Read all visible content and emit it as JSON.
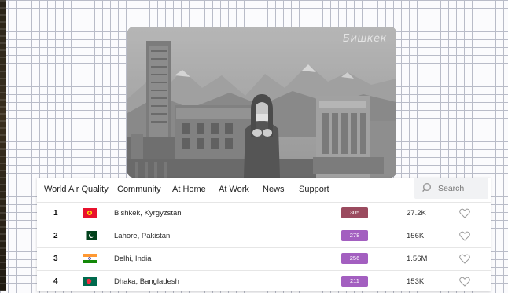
{
  "hero": {
    "city_caption": "Бишкек"
  },
  "nav": {
    "brand": "World Air Quality",
    "items": [
      "Community",
      "At Home",
      "At Work",
      "News",
      "Support"
    ]
  },
  "search": {
    "label": "Search",
    "icon": "search-icon"
  },
  "rows": [
    {
      "rank": "1",
      "city": "Bishkek, Kyrgyzstan",
      "aqi": "305",
      "aqi_color": "#9a4a5e",
      "count": "27.2K",
      "flag": "kyrgyzstan-flag"
    },
    {
      "rank": "2",
      "city": "Lahore, Pakistan",
      "aqi": "278",
      "aqi_color": "#a35fc0",
      "count": "156K",
      "flag": "pakistan-flag"
    },
    {
      "rank": "3",
      "city": "Delhi, India",
      "aqi": "256",
      "aqi_color": "#a35fc0",
      "count": "1.56M",
      "flag": "india-flag"
    },
    {
      "rank": "4",
      "city": "Dhaka, Bangladesh",
      "aqi": "211",
      "aqi_color": "#a35fc0",
      "count": "153K",
      "flag": "bangladesh-flag"
    }
  ]
}
